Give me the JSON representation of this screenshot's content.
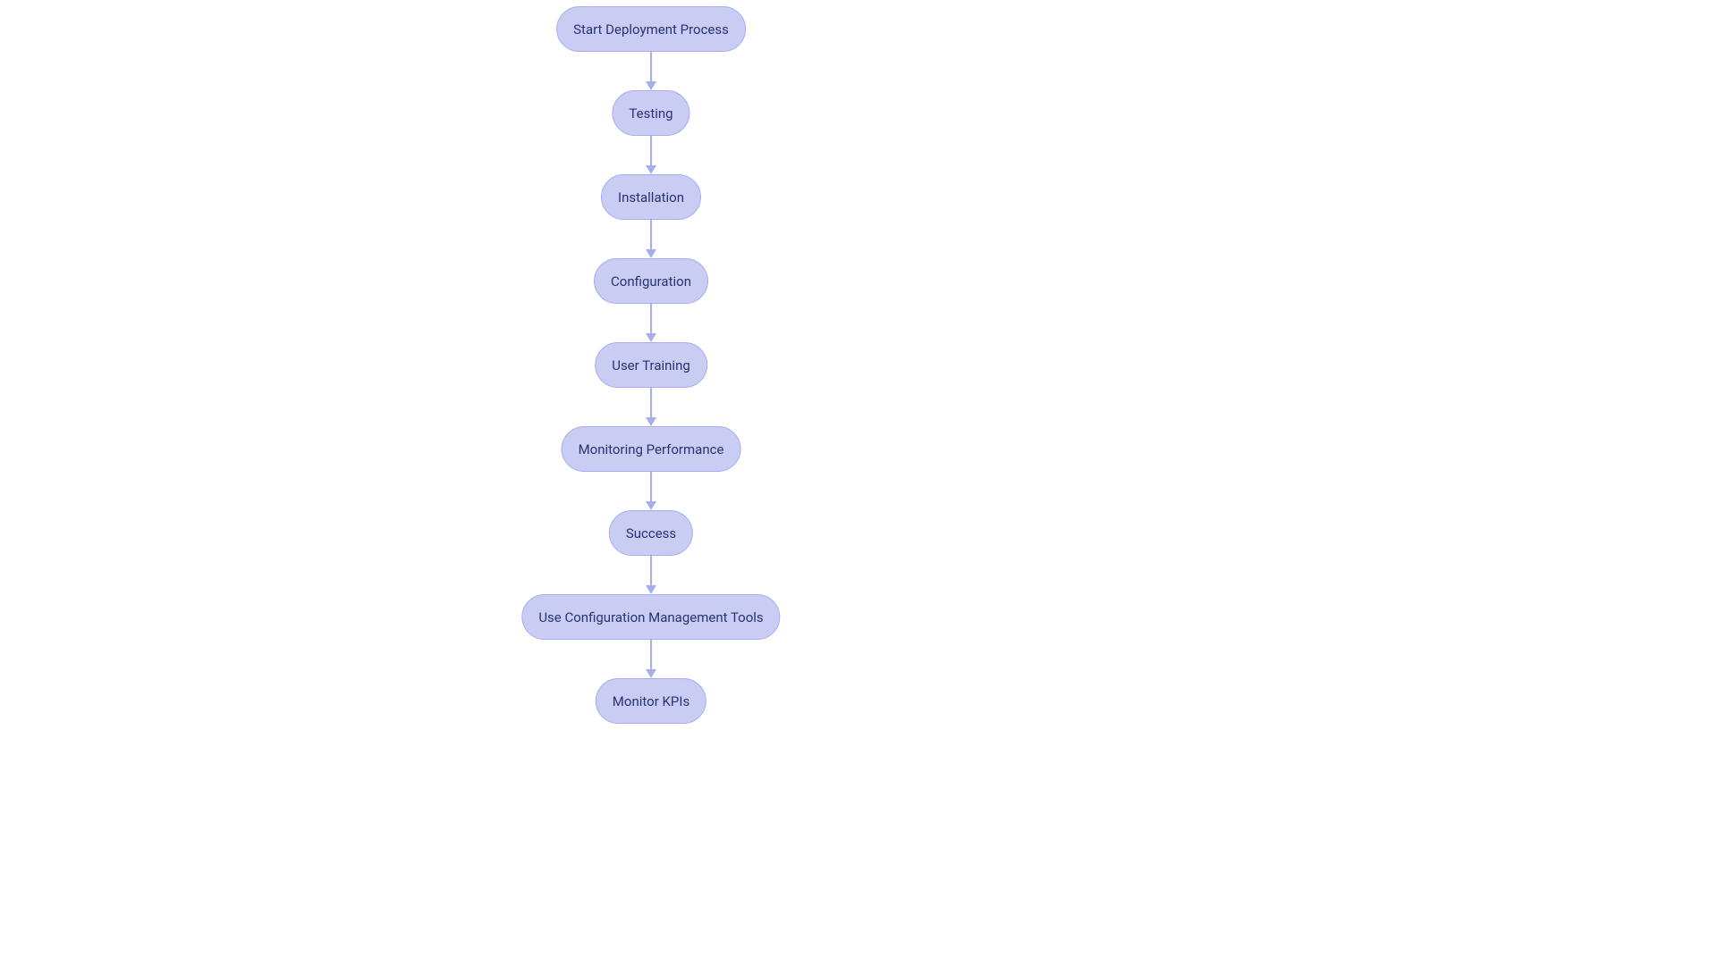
{
  "chart_data": {
    "type": "flowchart",
    "direction": "top-down",
    "nodes": [
      {
        "id": "n1",
        "label": "Start Deployment Process"
      },
      {
        "id": "n2",
        "label": "Testing"
      },
      {
        "id": "n3",
        "label": "Installation"
      },
      {
        "id": "n4",
        "label": "Configuration"
      },
      {
        "id": "n5",
        "label": "User Training"
      },
      {
        "id": "n6",
        "label": "Monitoring Performance"
      },
      {
        "id": "n7",
        "label": "Success"
      },
      {
        "id": "n8",
        "label": "Use Configuration Management Tools"
      },
      {
        "id": "n9",
        "label": "Monitor KPIs"
      }
    ],
    "edges": [
      {
        "from": "n1",
        "to": "n2"
      },
      {
        "from": "n2",
        "to": "n3"
      },
      {
        "from": "n3",
        "to": "n4"
      },
      {
        "from": "n4",
        "to": "n5"
      },
      {
        "from": "n5",
        "to": "n6"
      },
      {
        "from": "n6",
        "to": "n7"
      },
      {
        "from": "n7",
        "to": "n8"
      },
      {
        "from": "n8",
        "to": "n9"
      }
    ],
    "style": {
      "node_fill": "#c9cdf4",
      "node_border": "#a7aeeb",
      "text_color": "#2a3370",
      "arrow_color": "#a7aeeb",
      "node_shape": "stadium"
    }
  },
  "layout": {
    "centerX": 728,
    "nodeHeight": 51,
    "gap": 44,
    "startTop": 7
  }
}
